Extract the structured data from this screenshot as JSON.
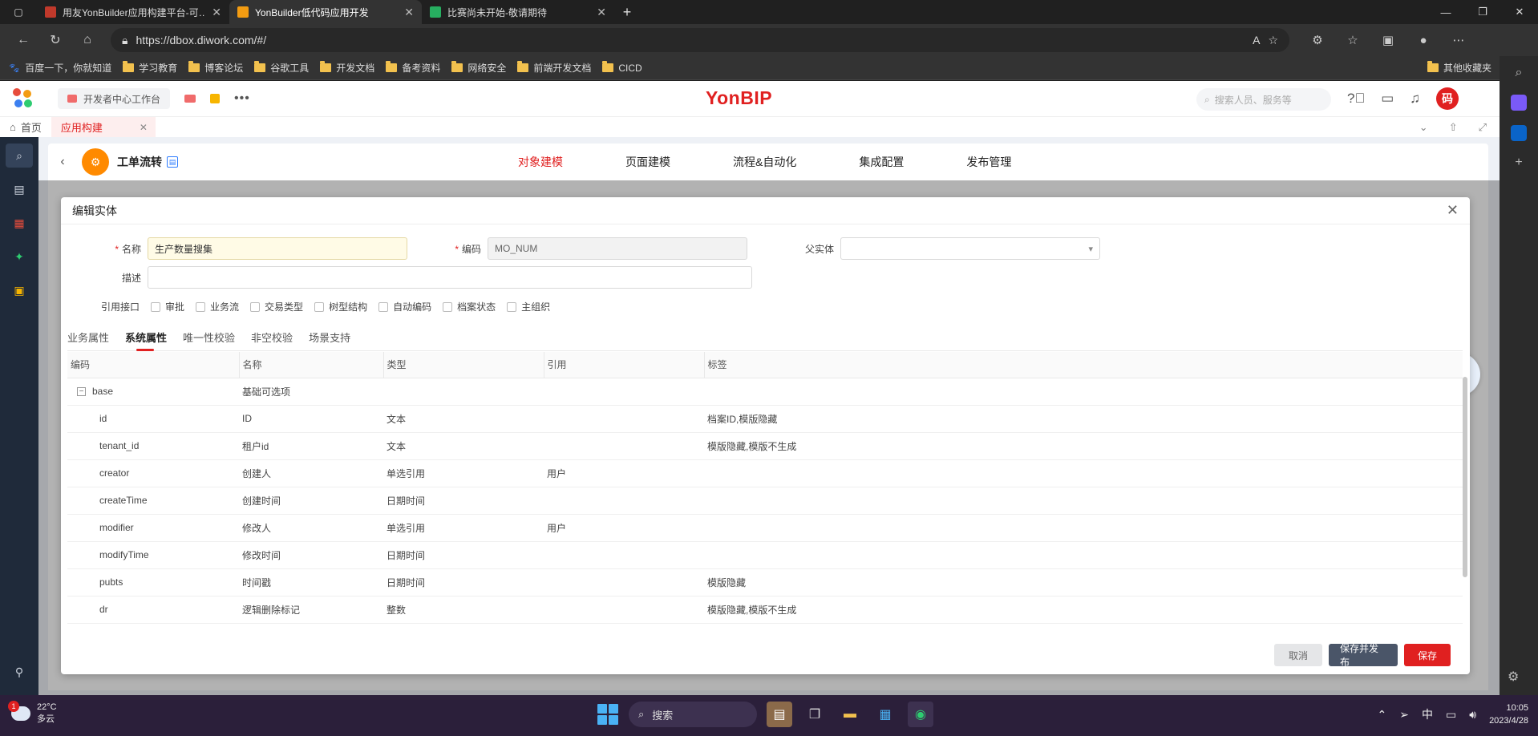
{
  "browser": {
    "tabs": [
      {
        "title": "用友YonBuilder应用构建平台-可…",
        "fav_color": "#c0392b",
        "active": false
      },
      {
        "title": "YonBuilder低代码应用开发",
        "fav_color": "#f39c12",
        "active": true
      },
      {
        "title": "比赛尚未开始-敬请期待",
        "fav_color": "#27ae60",
        "active": false
      }
    ],
    "url": "https://dbox.diwork.com/#/",
    "bookmarks": [
      "百度一下，你就知道",
      "学习教育",
      "博客论坛",
      "谷歌工具",
      "开发文档",
      "备考资料",
      "网络安全",
      "前端开发文档",
      "CICD"
    ],
    "bookmarks_right": "其他收藏夹"
  },
  "header": {
    "workbench": "开发者中心工作台",
    "brand": "YonBIP",
    "search_placeholder": "搜索人员、服务等",
    "avatar": "码"
  },
  "app_tabs": [
    {
      "label": "首页"
    },
    {
      "label": "应用构建"
    }
  ],
  "module": {
    "title": "工单流转",
    "nav": [
      "对象建模",
      "页面建模",
      "流程&自动化",
      "集成配置",
      "发布管理"
    ],
    "nav_active": 0
  },
  "modal": {
    "title": "编辑实体",
    "fields": {
      "name_label": "名称",
      "name_value": "生产数量搜集",
      "code_label": "编码",
      "code_value": "MO_NUM",
      "parent_label": "父实体",
      "parent_value": "",
      "desc_label": "描述",
      "desc_value": ""
    },
    "interfaces_label": "引用接口",
    "interfaces": [
      "审批",
      "业务流",
      "交易类型",
      "树型结构",
      "自动编码",
      "档案状态",
      "主组织"
    ],
    "subtabs": [
      "业务属性",
      "系统属性",
      "唯一性校验",
      "非空校验",
      "场景支持"
    ],
    "subtab_active": 1,
    "table": {
      "headers": [
        "编码",
        "名称",
        "类型",
        "引用",
        "标签"
      ],
      "group": {
        "code": "base",
        "name": "基础可选项"
      },
      "rows": [
        {
          "code": "id",
          "name": "ID",
          "type": "文本",
          "ref": "",
          "tag": "档案ID,模版隐藏"
        },
        {
          "code": "tenant_id",
          "name": "租户id",
          "type": "文本",
          "ref": "",
          "tag": "模版隐藏,模版不生成"
        },
        {
          "code": "creator",
          "name": "创建人",
          "type": "单选引用",
          "ref": "用户",
          "tag": ""
        },
        {
          "code": "createTime",
          "name": "创建时间",
          "type": "日期时间",
          "ref": "",
          "tag": ""
        },
        {
          "code": "modifier",
          "name": "修改人",
          "type": "单选引用",
          "ref": "用户",
          "tag": ""
        },
        {
          "code": "modifyTime",
          "name": "修改时间",
          "type": "日期时间",
          "ref": "",
          "tag": ""
        },
        {
          "code": "pubts",
          "name": "时间戳",
          "type": "日期时间",
          "ref": "",
          "tag": "模版隐藏"
        },
        {
          "code": "dr",
          "name": "逻辑删除标记",
          "type": "整数",
          "ref": "",
          "tag": "模版隐藏,模版不生成"
        }
      ]
    },
    "buttons": {
      "cancel": "取消",
      "save_publish": "保存并发布",
      "save": "保存"
    }
  },
  "taskbar": {
    "weather_temp": "22°C",
    "weather_desc": "多云",
    "weather_badge": "1",
    "search": "搜索",
    "ime": "中",
    "time": "10:05",
    "date": "2023/4/28"
  }
}
